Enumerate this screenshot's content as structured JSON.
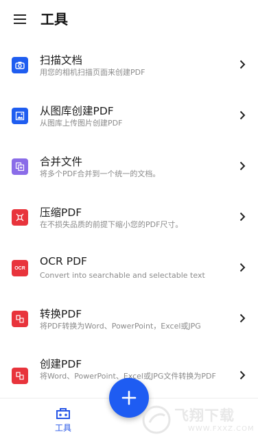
{
  "appbar": {
    "title": "工具",
    "menu_icon": "hamburger-menu-icon"
  },
  "tools": [
    {
      "title": "扫描文档",
      "subtitle": "用您的相机扫描页面来创建PDF",
      "icon": "camera-icon",
      "color": "#1f5df0"
    },
    {
      "title": "从图库创建PDF",
      "subtitle": "从图库上传图片创建PDF",
      "icon": "image-icon",
      "color": "#1f5df0"
    },
    {
      "title": "合并文件",
      "subtitle": "将多个PDF合并到一个统一的文档。",
      "icon": "merge-icon",
      "color": "#8a6ce8"
    },
    {
      "title": "压缩PDF",
      "subtitle": "在不损失品质的前提下缩小您的PDF尺寸。",
      "icon": "compress-icon",
      "color": "#e8343c"
    },
    {
      "title": "OCR PDF",
      "subtitle": "Convert into searchable and selectable text",
      "icon": "ocr-icon",
      "color": "#e8343c",
      "icon_text": "OCR"
    },
    {
      "title": "转换PDF",
      "subtitle": "将PDF转换为Word、PowerPoint，Excel或JPG",
      "icon": "convert-icon",
      "color": "#e8343c"
    },
    {
      "title": "创建PDF",
      "subtitle": "将Word、PowerPoint、Excel或JPG文件转换为PDF",
      "icon": "create-icon",
      "color": "#e8343c"
    }
  ],
  "bottom_nav": {
    "tools_label": "工具",
    "tools_icon": "toolbox-icon",
    "active_color": "#2454e6"
  },
  "fab": {
    "icon": "plus-icon",
    "color": "#1e5cf2"
  },
  "watermark": {
    "text": "飞翔下载",
    "url": "WWW.FXXZ.COM"
  }
}
